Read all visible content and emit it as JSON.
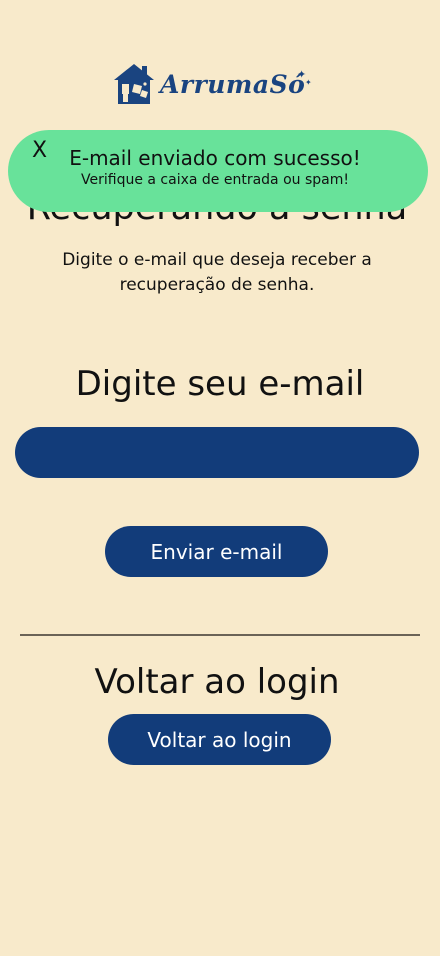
{
  "logo": {
    "name": "ArrumaSó",
    "icon": "house-cleaning-icon",
    "accent": "#1a4480"
  },
  "page": {
    "title": "Recuperando a  senha",
    "subtitle": "Digite o e-mail que deseja receber a recuperação de senha."
  },
  "email_section": {
    "heading": "Digite seu e-mail",
    "input_value": "",
    "send_button": "Enviar e-mail"
  },
  "login_section": {
    "heading": "Voltar ao login",
    "button": "Voltar ao login"
  },
  "toast": {
    "close_label": "X",
    "title": "E-mail enviado com sucesso!",
    "message": "Verifique a caixa de entrada ou spam!",
    "color": "#68e29a"
  },
  "colors": {
    "background": "#f8eacb",
    "primary": "#123c7a"
  }
}
